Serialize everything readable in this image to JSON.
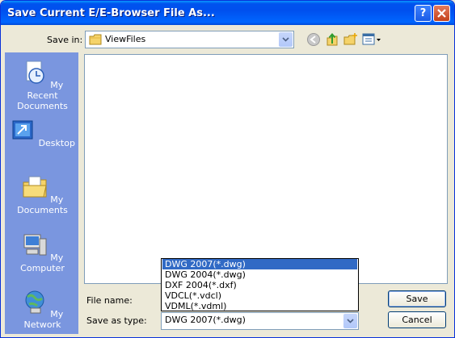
{
  "window": {
    "title": "Save Current E/E-Browser File As..."
  },
  "toolbar": {
    "save_in_label": "Save in:",
    "save_in_value": "ViewFiles"
  },
  "places": [
    {
      "label": "My Recent\nDocuments",
      "icon": "recent-documents-icon"
    },
    {
      "label": "Desktop",
      "icon": "desktop-icon"
    },
    {
      "label": "My Documents",
      "icon": "my-documents-icon"
    },
    {
      "label": "My Computer",
      "icon": "my-computer-icon"
    },
    {
      "label": "My Network",
      "icon": "my-network-icon"
    }
  ],
  "form": {
    "file_name_label": "File name:",
    "save_as_type_label": "Save as type:",
    "save_as_type_value": "DWG 2007(*.dwg)",
    "save_button": "Save",
    "cancel_button": "Cancel"
  },
  "type_options": [
    "DWG 2007(*.dwg)",
    "DWG 2004(*.dwg)",
    "DXF 2004(*.dxf)",
    "VDCL(*.vdcl)",
    "VDML(*.vdml)"
  ],
  "colors": {
    "titlebar": "#0054e3",
    "places_bar": "#7a96df",
    "selection": "#316ac5"
  }
}
